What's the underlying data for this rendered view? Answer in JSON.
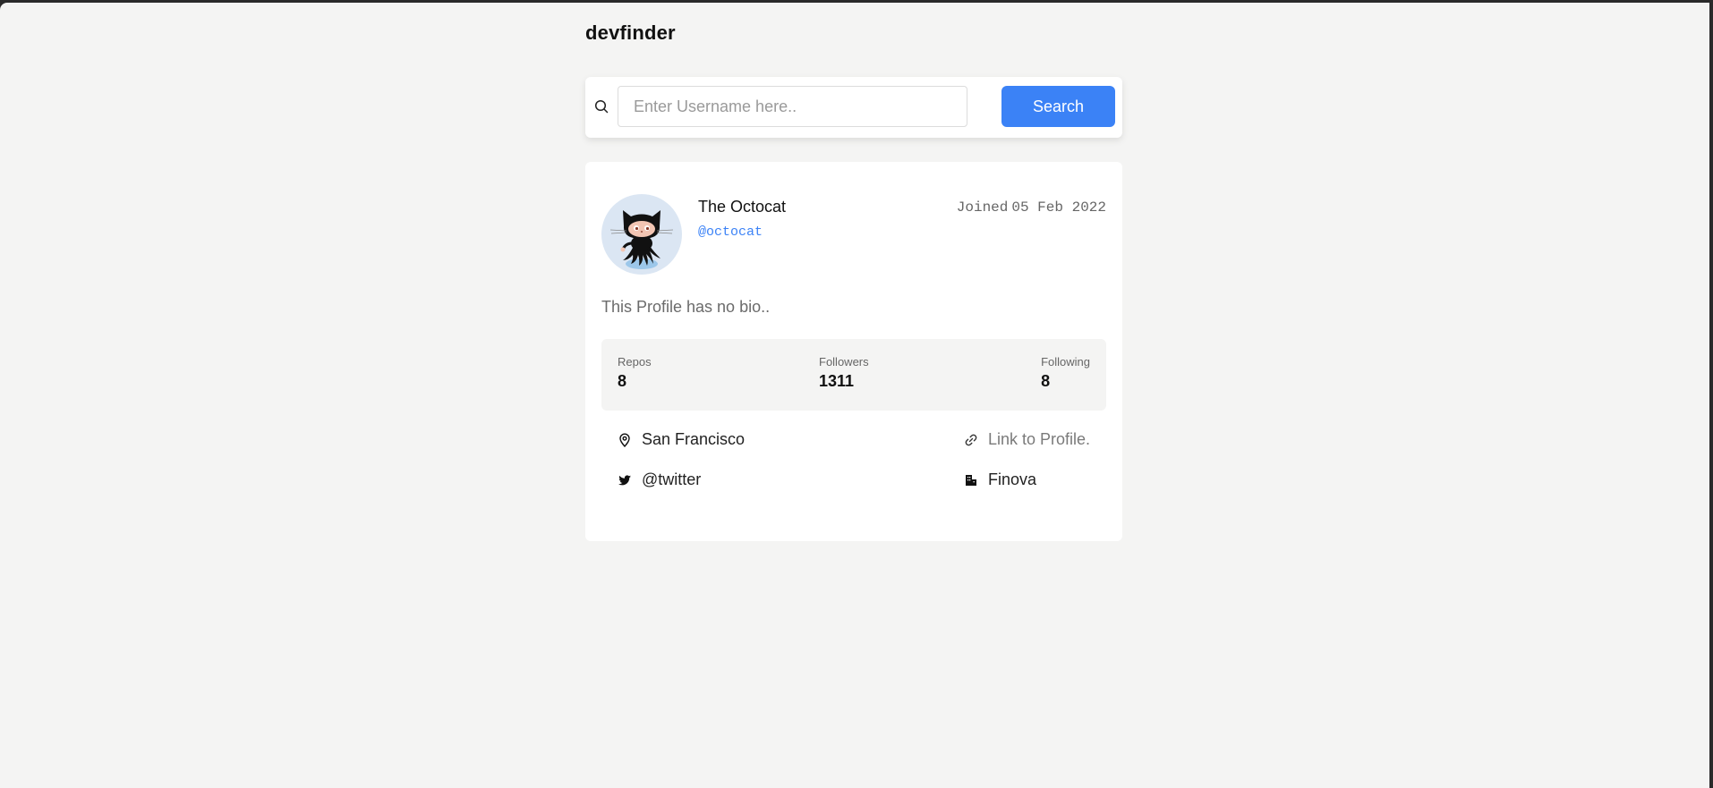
{
  "app": {
    "brand": "devfinder"
  },
  "search": {
    "placeholder": "Enter Username here..",
    "value": "",
    "button_label": "Search"
  },
  "profile": {
    "name": "The Octocat",
    "handle": "@octocat",
    "joined_label": "Joined",
    "joined_date": "05 Feb 2022",
    "bio": "This Profile has no bio..",
    "avatar_icon": "octocat-avatar"
  },
  "stats": {
    "repos_label": "Repos",
    "repos_value": "8",
    "followers_label": "Followers",
    "followers_value": "1311",
    "following_label": "Following",
    "following_value": "8"
  },
  "info": {
    "location": "San Francisco",
    "link": "Link to Profile.",
    "twitter": "@twitter",
    "company": "Finova"
  },
  "colors": {
    "accent": "#3b82f6",
    "page_bg": "#f4f4f3",
    "card_bg": "#ffffff"
  }
}
